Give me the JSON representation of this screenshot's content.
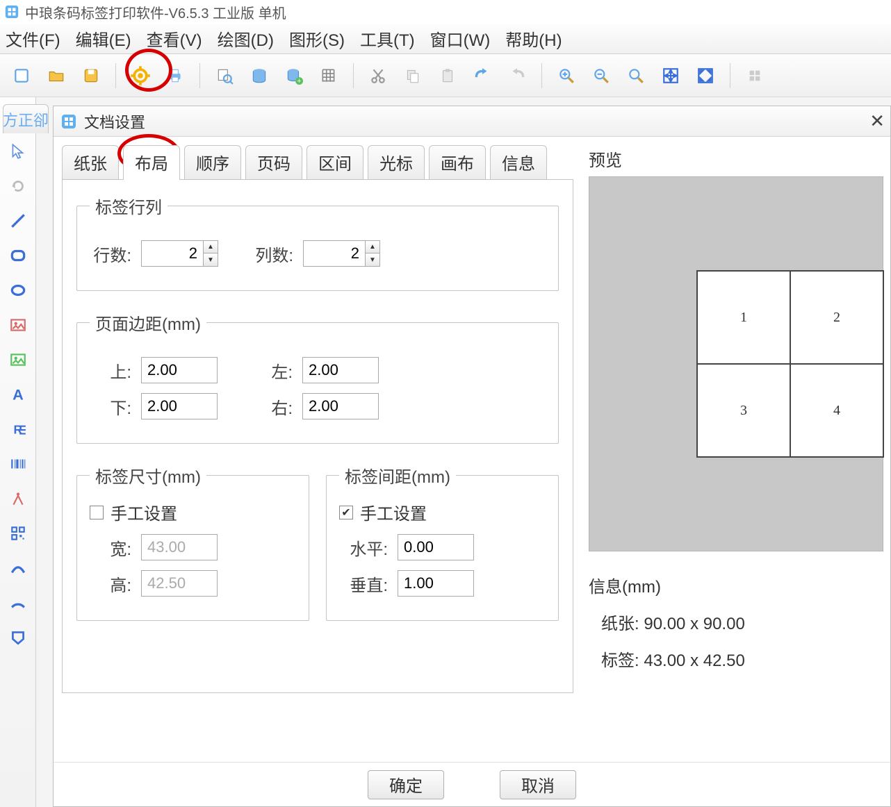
{
  "app": {
    "title": "中琅条码标签打印软件-V6.5.3 工业版 单机"
  },
  "menu": {
    "file": "文件(F)",
    "edit": "编辑(E)",
    "view": "查看(V)",
    "draw": "绘图(D)",
    "graphic": "图形(S)",
    "tool": "工具(T)",
    "window": "窗口(W)",
    "help": "帮助(H)"
  },
  "doc_tab": "方正卻",
  "dialog": {
    "title": "文档设置",
    "tabs": {
      "paper": "纸张",
      "layout": "布局",
      "order": "顺序",
      "page": "页码",
      "range": "区间",
      "cursor": "光标",
      "canvas": "画布",
      "info": "信息"
    },
    "layout": {
      "rowcol_group": "标签行列",
      "rows_label": "行数:",
      "rows_value": "2",
      "cols_label": "列数:",
      "cols_value": "2",
      "margin_group": "页面边距(mm)",
      "top_label": "上:",
      "top_value": "2.00",
      "left_label": "左:",
      "left_value": "2.00",
      "bottom_label": "下:",
      "bottom_value": "2.00",
      "right_label": "右:",
      "right_value": "2.00",
      "size_group": "标签尺寸(mm)",
      "size_manual": "手工设置",
      "size_manual_checked": false,
      "width_label": "宽:",
      "width_value": "43.00",
      "height_label": "高:",
      "height_value": "42.50",
      "gap_group": "标签间距(mm)",
      "gap_manual": "手工设置",
      "gap_manual_checked": true,
      "h_label": "水平:",
      "h_value": "0.00",
      "v_label": "垂直:",
      "v_value": "1.00"
    },
    "preview": {
      "label": "预览",
      "cells": [
        "1",
        "2",
        "3",
        "4"
      ]
    },
    "info_box": {
      "title": "信息(mm)",
      "paper_label": "纸张:",
      "paper_value": "90.00 x 90.00",
      "label_label": "标签:",
      "label_value": "43.00 x 42.50"
    },
    "buttons": {
      "ok": "确定",
      "cancel": "取消"
    }
  }
}
